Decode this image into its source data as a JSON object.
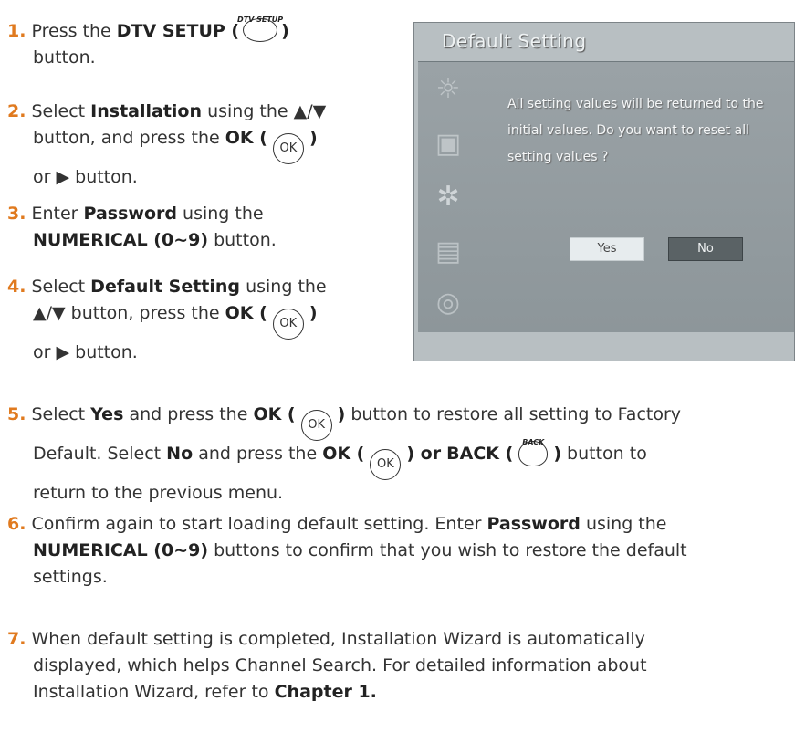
{
  "steps": [
    {
      "num": "1.",
      "pre": "Press the",
      "b1": "DTV SETUP (",
      "b1end": ")",
      "line2": "button.",
      "btn_label": "DTV SETUP"
    },
    {
      "num": "2.",
      "pre": "Select",
      "b1": "Installation",
      "mid": "using the ▲/▼",
      "line2": "button, and press the",
      "b2": "OK (",
      "ok": "OK",
      "b2end": ")",
      "line3": "or ▶ button."
    },
    {
      "num": "3.",
      "pre": "Enter",
      "b1": "Password",
      "mid": "using the",
      "b2": "NUMERICAL (0~9)",
      "tail": "button."
    },
    {
      "num": "4.",
      "pre": "Select",
      "b1": "Default Setting",
      "mid": "using the",
      "line2": "▲/▼ button, press the",
      "b2": "OK (",
      "ok": "OK",
      "b2end": ")",
      "line3": "or ▶ button."
    },
    {
      "num": "5.",
      "pre": "Select",
      "b1": "Yes",
      "mid": "and press the",
      "b2": "OK (",
      "ok": "OK",
      "b2end": ")",
      "tail": "button to restore all setting to Factory",
      "line2": "Default. Select",
      "b3": "No",
      "mid2": "and press the",
      "b4": "OK (",
      "ok2": "OK",
      "b4end": ") or",
      "b5": "BACK (",
      "back_label": "BACK",
      "b5end": ")",
      "tail2": "button to",
      "line3": "return to the previous menu."
    },
    {
      "num": "6.",
      "line1": "Confirm again to start loading default setting. Enter",
      "b1": "Password",
      "tail": "using the",
      "b2": "NUMERICAL (0~9)",
      "line2": "buttons to confirm that you wish to restore the default",
      "line3": "settings."
    },
    {
      "num": "7.",
      "line1": "When default setting is completed, Installation Wizard is automatically",
      "line2": "displayed, which helps Channel Search. For detailed information about",
      "line3": "Installation Wizard, refer to",
      "b1": "Chapter 1."
    }
  ],
  "tv": {
    "title": "Default Setting",
    "message": "All setting values will be returned to the initial values. Do you want to reset all setting values ?",
    "yes": "Yes",
    "no": "No"
  }
}
